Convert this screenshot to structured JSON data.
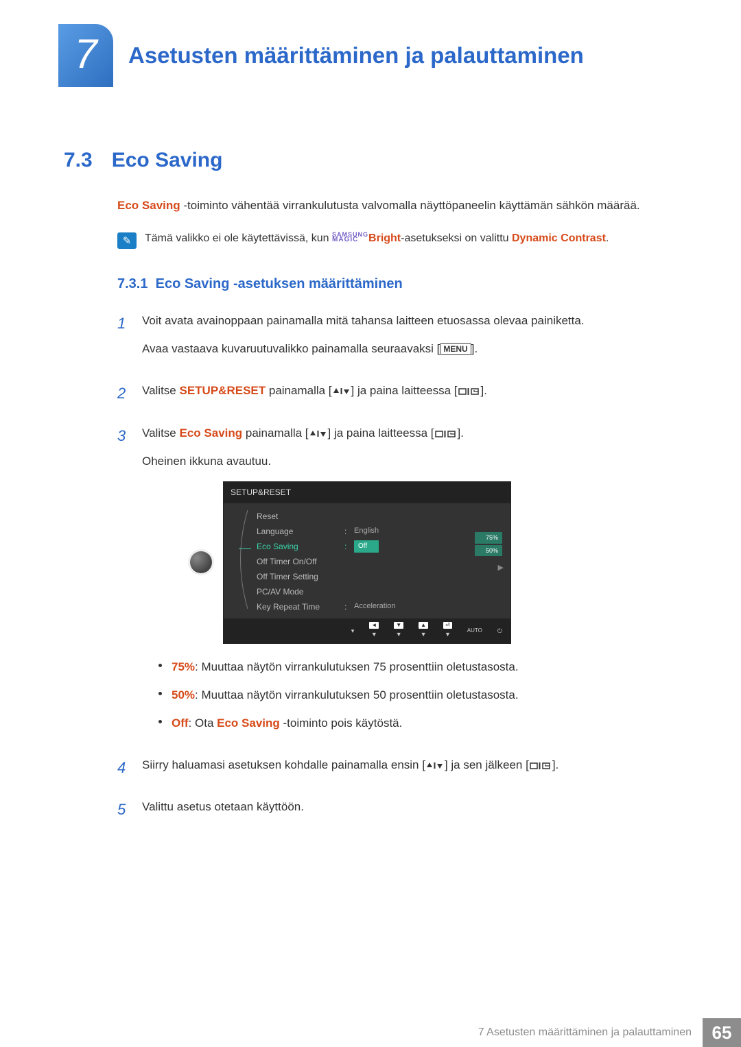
{
  "chapter": {
    "number": "7",
    "title": "Asetusten määrittäminen ja palauttaminen"
  },
  "section": {
    "number": "7.3",
    "title": "Eco Saving"
  },
  "intro": {
    "lead": "Eco Saving",
    "rest": " -toiminto vähentää virrankulutusta valvomalla näyttöpaneelin käyttämän sähkön määrää."
  },
  "note": {
    "pre": "Tämä valikko ei ole käytettävissä, kun ",
    "samsung_top": "SAMSUNG",
    "samsung_bot": "MAGIC",
    "bright": "Bright",
    "mid": "-asetukseksi on valittu ",
    "dc": "Dynamic Contrast",
    "end": "."
  },
  "subsection": {
    "number": "7.3.1",
    "title": "Eco Saving -asetuksen määrittäminen"
  },
  "steps": {
    "s1a": "Voit avata avainoppaan painamalla mitä tahansa laitteen etuosassa olevaa painiketta.",
    "s1b_pre": "Avaa vastaava kuvaruutuvalikko painamalla seuraavaksi [",
    "s1b_menu": "MENU",
    "s1b_post": "].",
    "s2_pre": "Valitse ",
    "s2_setup": "SETUP&RESET",
    "s2_mid": " painamalla [",
    "s2_mid2": "] ja paina laitteessa [",
    "s2_end": "].",
    "s3_pre": "Valitse ",
    "s3_eco": "Eco Saving",
    "s3_mid": " painamalla [",
    "s3_mid2": "] ja paina laitteessa [",
    "s3_end": "].",
    "s3_next": "Oheinen ikkuna avautuu.",
    "b1_lead": "75%",
    "b1_rest": ": Muuttaa näytön virrankulutuksen 75 prosenttiin oletustasosta.",
    "b2_lead": "50%",
    "b2_rest": ": Muuttaa näytön virrankulutuksen 50 prosenttiin oletustasosta.",
    "b3_off": "Off",
    "b3_mid": ": Ota ",
    "b3_eco": "Eco Saving",
    "b3_rest": " -toiminto pois käytöstä.",
    "s4_pre": "Siirry haluamasi asetuksen kohdalle painamalla ensin [",
    "s4_mid": "] ja sen jälkeen [",
    "s4_end": "].",
    "s5": "Valittu asetus otetaan käyttöön."
  },
  "step_labels": {
    "n1": "1",
    "n2": "2",
    "n3": "3",
    "n4": "4",
    "n5": "5"
  },
  "osd": {
    "title": "SETUP&RESET",
    "rows": {
      "reset": "Reset",
      "language": "Language",
      "language_val": "English",
      "eco": "Eco Saving",
      "eco_val": "Off",
      "timer_onoff": "Off Timer On/Off",
      "timer_setting": "Off Timer Setting",
      "pcav": "PC/AV Mode",
      "key_repeat": "Key Repeat Time",
      "key_repeat_val": "Acceleration"
    },
    "tags": {
      "t75": "75%",
      "t50": "50%"
    },
    "foot": {
      "auto": "AUTO"
    }
  },
  "footer": {
    "text": "7 Asetusten määrittäminen ja palauttaminen",
    "page": "65"
  }
}
